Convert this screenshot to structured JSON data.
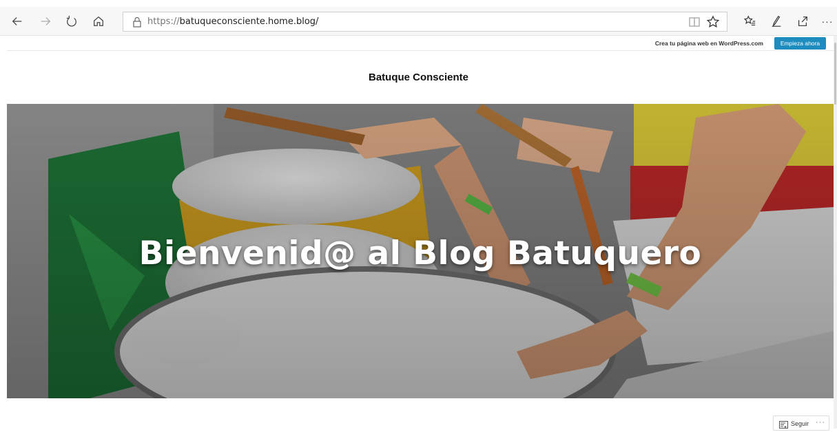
{
  "browser": {
    "url_protocol": "https://",
    "url_host": "batuqueconsciente.home.blog/",
    "icons": [
      "back-icon",
      "forward-icon",
      "refresh-icon",
      "home-icon",
      "lock-icon",
      "reading-view-icon",
      "favorite-star-icon",
      "favorites-list-icon",
      "pen-icon",
      "share-icon",
      "more-icon"
    ]
  },
  "wp_bar": {
    "promo_text": "Crea tu página web en WordPress.com",
    "cta_label": "Empieza ahora",
    "cta_color": "#1e8cbe"
  },
  "site": {
    "title": "Batuque Consciente"
  },
  "hero": {
    "heading": "Bienvenid@ al Blog Batuquero"
  },
  "follow": {
    "label": "Seguir",
    "more": "···"
  }
}
